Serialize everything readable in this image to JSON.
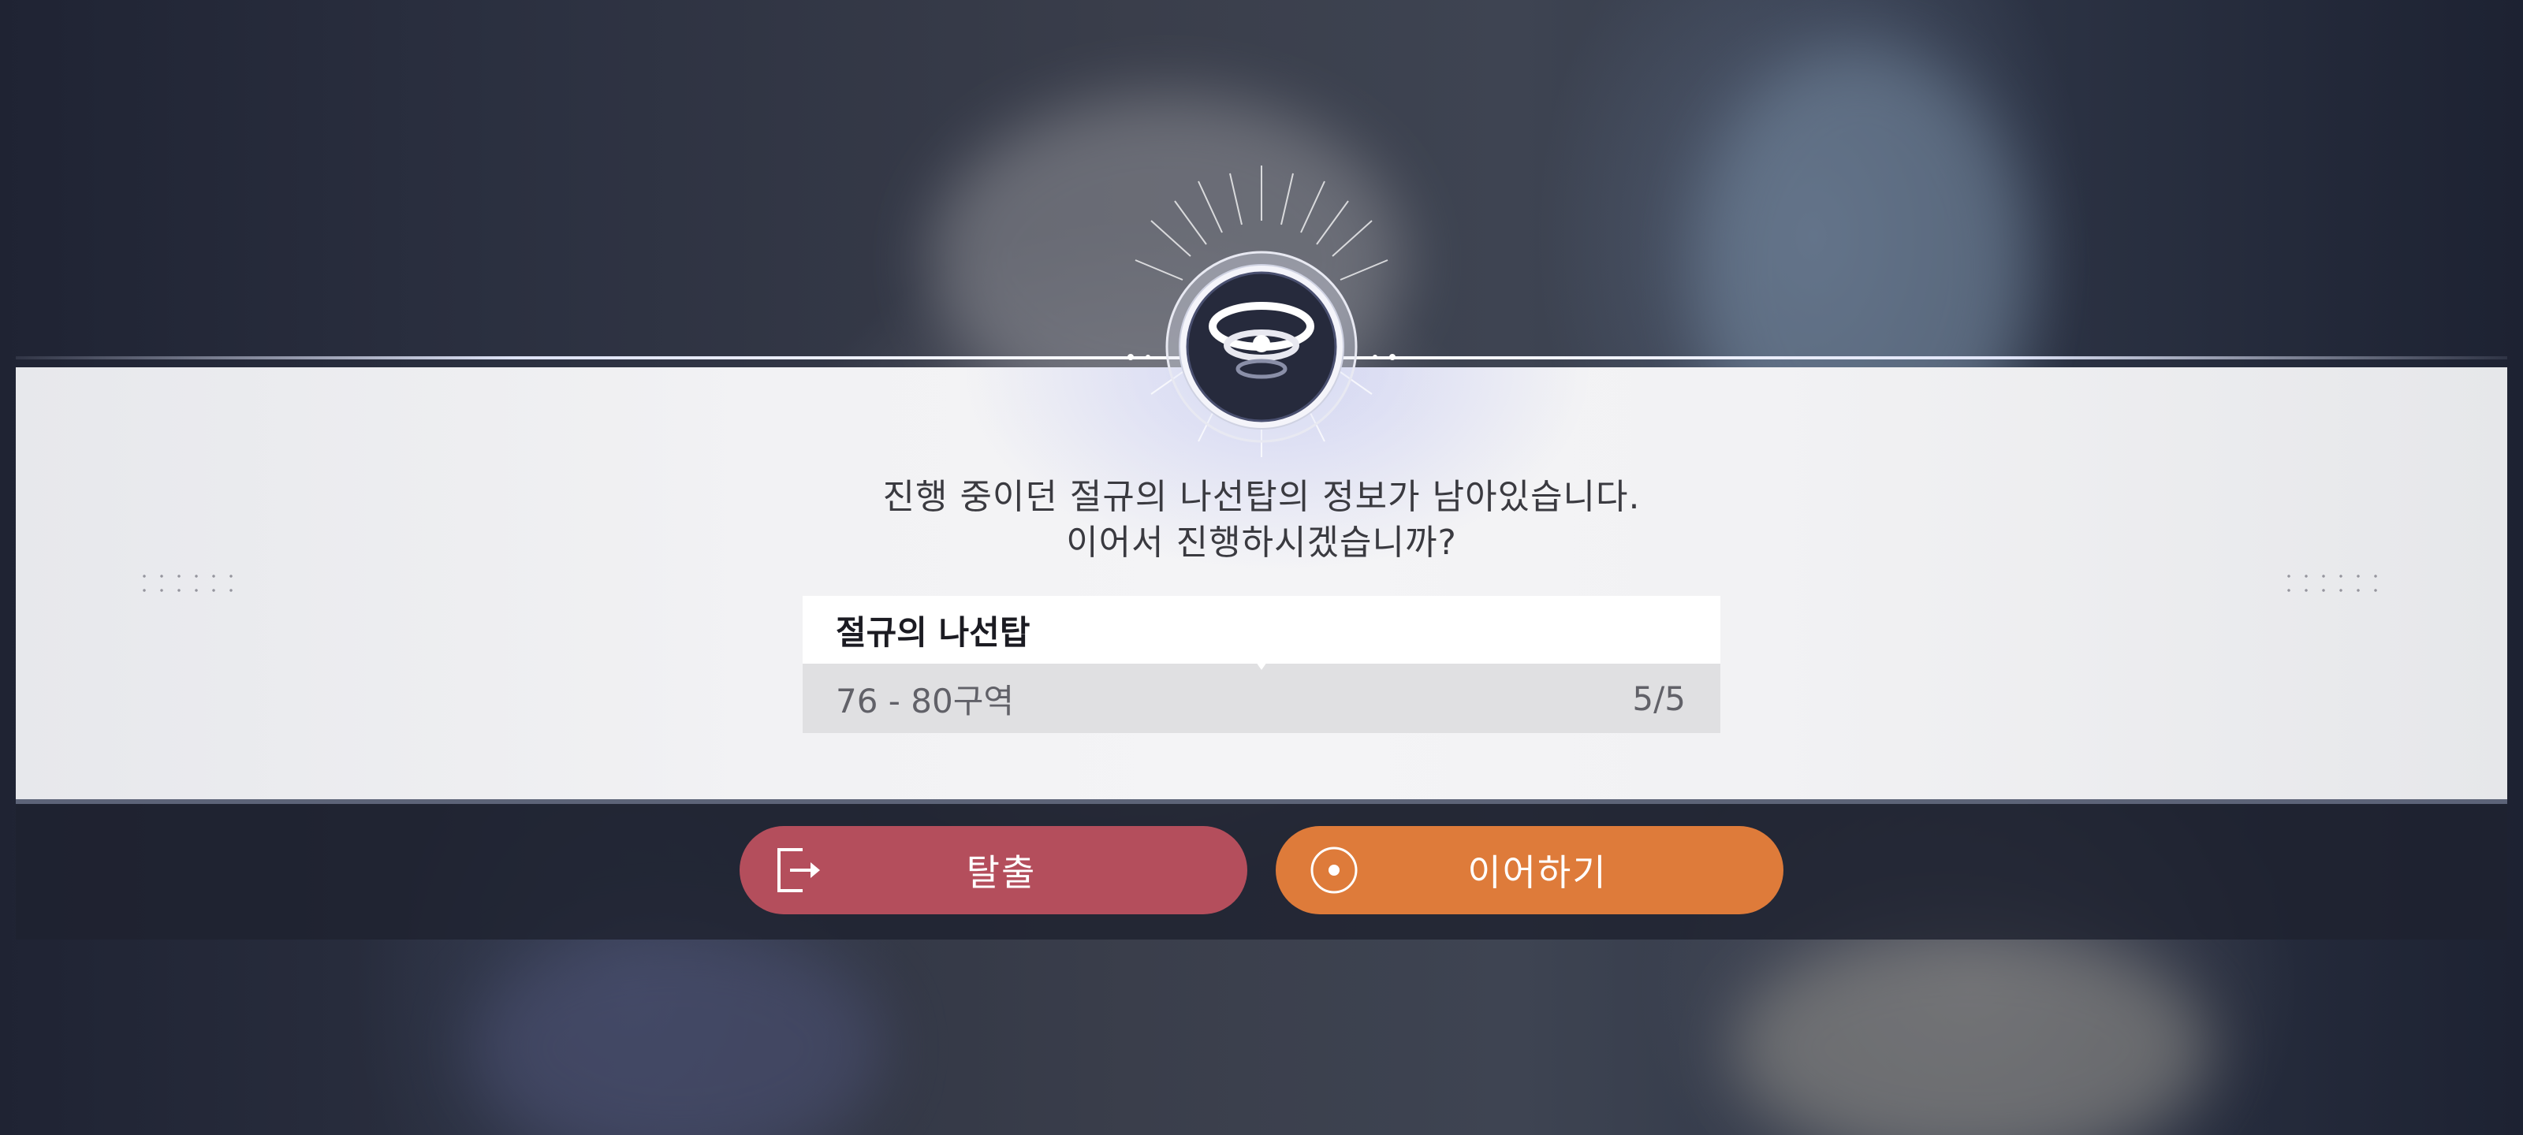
{
  "dialog": {
    "emblem_icon": "spiral-tower-emblem-icon",
    "message_line1": "진행 중이던 절규의 나선탑의 정보가 남아있습니다.",
    "message_line2": "이어서 진행하시겠습니까?",
    "card": {
      "title": "절규의 나선탑",
      "zone": "76 - 80구역",
      "progress": "5/5"
    }
  },
  "buttons": {
    "exit": {
      "label": "탈출",
      "icon": "exit-door-icon",
      "color": "#b44e5c"
    },
    "continue": {
      "label": "이어하기",
      "icon": "target-circle-icon",
      "color": "#de7b3a"
    }
  },
  "colors": {
    "panel": "#f2f2f4",
    "strip": "#1e2230",
    "text": "#3a3a40"
  }
}
